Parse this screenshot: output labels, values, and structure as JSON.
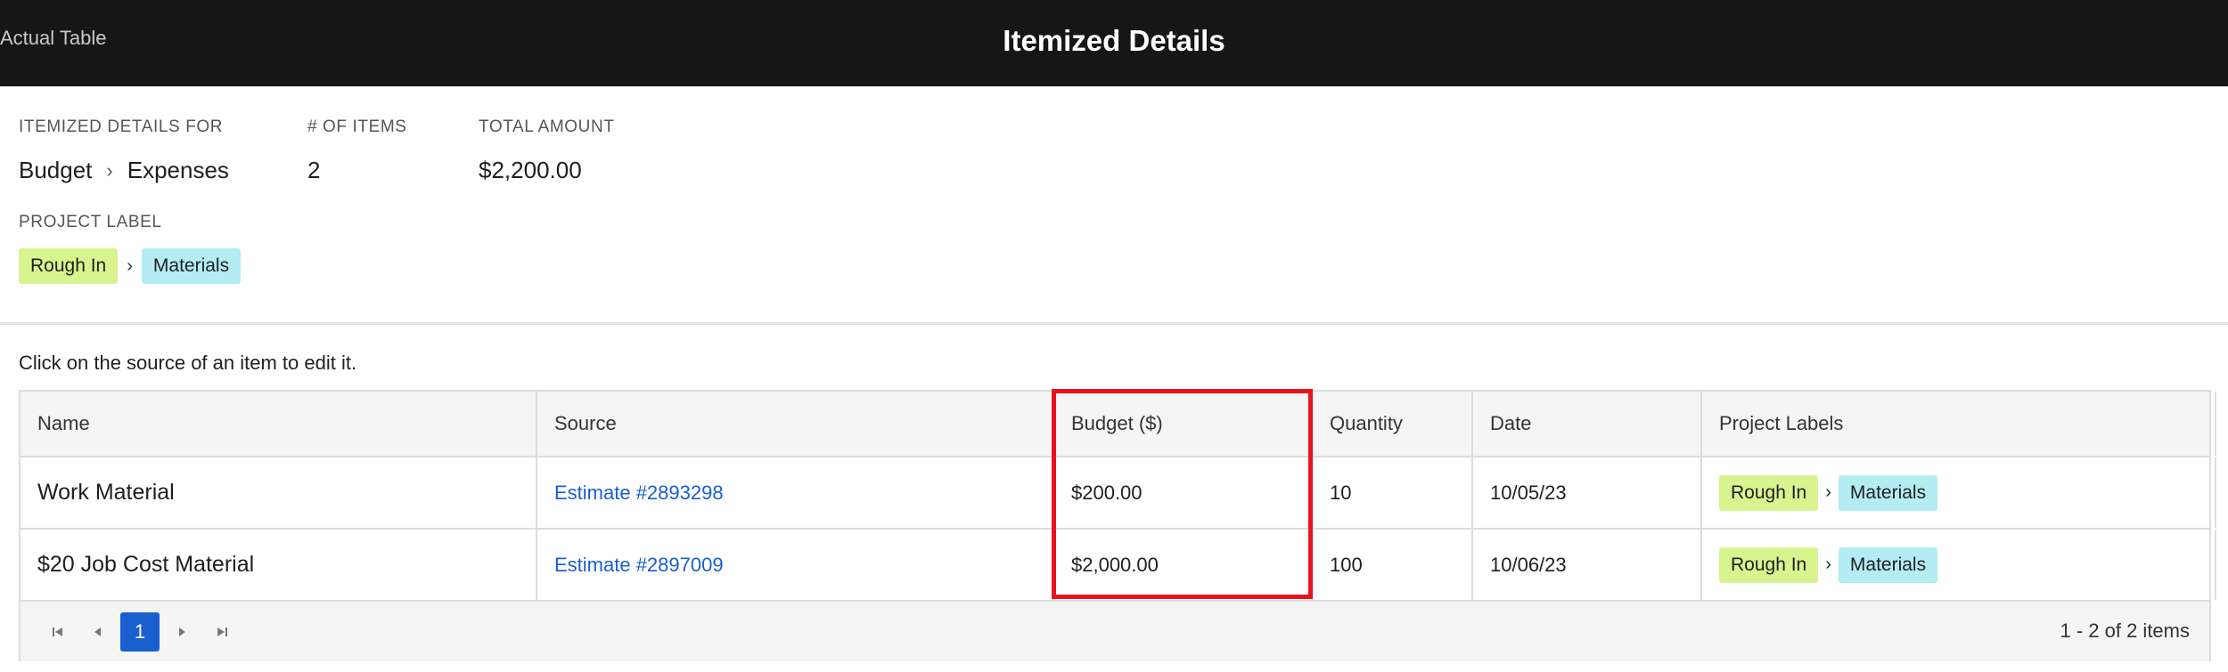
{
  "header": {
    "left_label": "Actual Table",
    "title": "Itemized Details"
  },
  "summary": {
    "for_label": "ITEMIZED DETAILS FOR",
    "for_path": [
      "Budget",
      "Expenses"
    ],
    "count_label": "# OF ITEMS",
    "count_value": "2",
    "total_label": "TOTAL AMOUNT",
    "total_value": "$2,200.00",
    "project_label_label": "PROJECT LABEL",
    "project_tags": [
      "Rough In",
      "Materials"
    ]
  },
  "hint": "Click on the source of an item to edit it.",
  "table": {
    "columns": [
      "Name",
      "Source",
      "Budget ($)",
      "Quantity",
      "Date",
      "Project Labels"
    ],
    "rows": [
      {
        "name": "Work Material",
        "source": "Estimate #2893298",
        "budget": "$200.00",
        "quantity": "10",
        "date": "10/05/23",
        "labels": [
          "Rough In",
          "Materials"
        ]
      },
      {
        "name": "$20 Job Cost Material",
        "source": "Estimate #2897009",
        "budget": "$2,000.00",
        "quantity": "100",
        "date": "10/06/23",
        "labels": [
          "Rough In",
          "Materials"
        ]
      }
    ]
  },
  "pager": {
    "current_page": "1",
    "info": "1 - 2 of 2 items"
  },
  "colors": {
    "header_bg": "#161616",
    "tag_green": "#d8f48f",
    "tag_cyan": "#b4ecf3",
    "link": "#1a5fd0",
    "highlight": "#e8141c"
  }
}
